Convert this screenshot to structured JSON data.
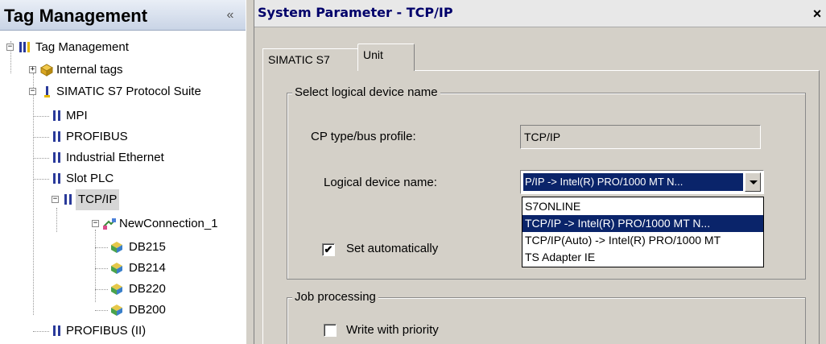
{
  "left_panel": {
    "title": "Tag Management",
    "collapse_glyph": "«",
    "tree": [
      {
        "label": "Tag Management",
        "icon": "tag-management-icon",
        "expander": "−"
      },
      {
        "label": "Internal tags",
        "icon": "internal-tags-icon",
        "expander": "+"
      },
      {
        "label": "SIMATIC S7 Protocol Suite",
        "icon": "protocol-suite-icon",
        "expander": "−"
      },
      {
        "label": "MPI",
        "icon": "channel-icon"
      },
      {
        "label": "PROFIBUS",
        "icon": "channel-icon"
      },
      {
        "label": "Industrial Ethernet",
        "icon": "channel-icon"
      },
      {
        "label": "Slot PLC",
        "icon": "channel-icon"
      },
      {
        "label": "TCP/IP",
        "icon": "channel-icon",
        "expander": "−",
        "selected": true
      },
      {
        "label": "NewConnection_1",
        "icon": "connection-icon",
        "expander": "−"
      },
      {
        "label": "DB215",
        "icon": "tag-group-icon"
      },
      {
        "label": "DB214",
        "icon": "tag-group-icon"
      },
      {
        "label": "DB220",
        "icon": "tag-group-icon"
      },
      {
        "label": "DB200",
        "icon": "tag-group-icon"
      },
      {
        "label": "PROFIBUS (II)",
        "icon": "channel-icon"
      }
    ]
  },
  "dialog": {
    "title": "System Parameter - TCP/IP",
    "close_glyph": "×",
    "tabs": [
      {
        "label": "SIMATIC S7",
        "active": false
      },
      {
        "label": "Unit",
        "active": true
      }
    ],
    "select_group": {
      "legend": "Select logical device name",
      "cp_label": "CP type/bus profile:",
      "cp_value": "TCP/IP",
      "ldn_label": "Logical device name:",
      "ldn_value": "P/IP -> Intel(R) PRO/1000 MT N...",
      "ldn_options": [
        "S7ONLINE",
        "TCP/IP -> Intel(R) PRO/1000 MT N...",
        "TCP/IP(Auto) -> Intel(R) PRO/1000 MT",
        "TS Adapter IE"
      ],
      "ldn_selected_index": 1,
      "set_auto_label": "Set automatically",
      "set_auto_checked": "✔"
    },
    "job_group": {
      "legend": "Job processing",
      "write_priority_label": "Write with priority"
    }
  }
}
